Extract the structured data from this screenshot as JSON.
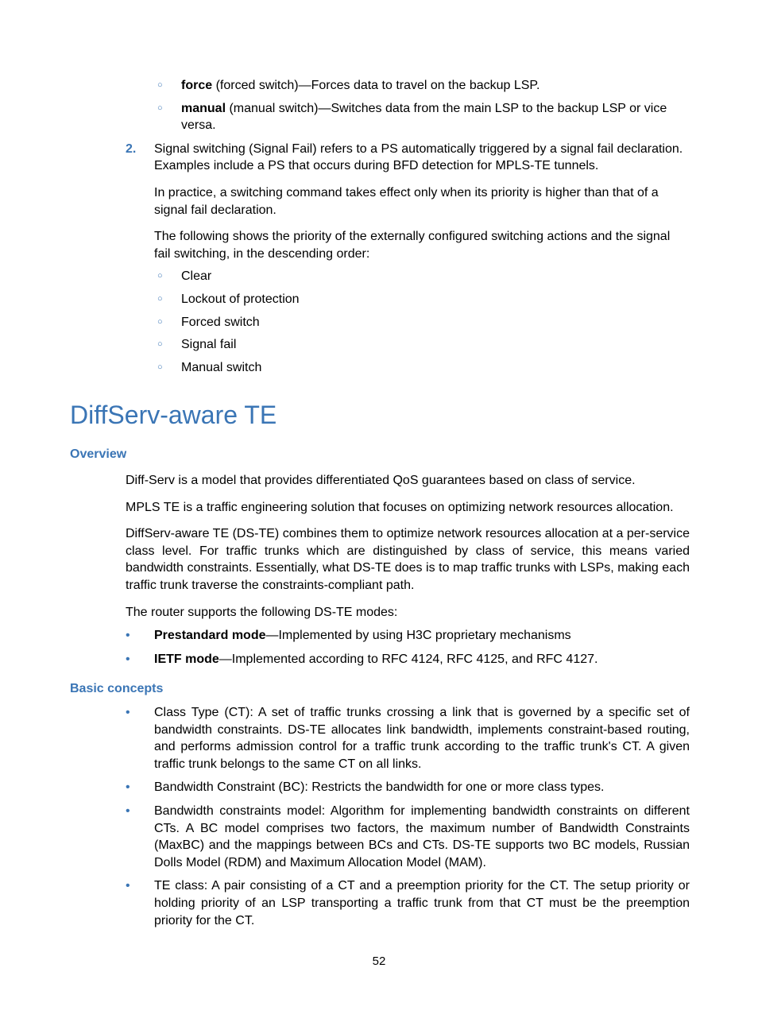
{
  "top": {
    "sub_items_a": [
      {
        "bold": "force",
        "rest": " (forced switch)—Forces data to travel on the backup LSP."
      },
      {
        "bold": "manual",
        "rest": " (manual switch)—Switches data from the main LSP to the backup LSP or vice versa."
      }
    ],
    "num2": "2.",
    "num2_text": "Signal switching (Signal Fail) refers to a PS automatically triggered by a signal fail declaration. Examples include a PS that occurs during BFD detection for MPLS-TE tunnels.",
    "num2_p2": "In practice, a switching command takes effect only when its priority is higher than that of a signal fail declaration.",
    "num2_p3": "The following shows the priority of the externally configured switching actions and the signal fail switching, in the descending order:",
    "priority_list": [
      "Clear",
      "Lockout of protection",
      "Forced switch",
      "Signal fail",
      "Manual switch"
    ]
  },
  "section_title": "DiffServ-aware TE",
  "overview": {
    "heading": "Overview",
    "p1": "Diff-Serv is a model that provides differentiated QoS guarantees based on class of service.",
    "p2": "MPLS TE is a traffic engineering solution that focuses on optimizing network resources allocation.",
    "p3": "DiffServ-aware TE (DS-TE) combines them to optimize network resources allocation at a per-service class level. For traffic trunks which are distinguished by class of service, this means varied bandwidth constraints. Essentially, what DS-TE does is to map traffic trunks with LSPs, making each traffic trunk traverse the constraints-compliant path.",
    "p4": "The router supports the following DS-TE modes:",
    "modes": [
      {
        "bold": "Prestandard mode",
        "rest": "—Implemented by using H3C proprietary mechanisms"
      },
      {
        "bold": "IETF mode",
        "rest": "—Implemented according to RFC 4124, RFC 4125, and RFC 4127."
      }
    ]
  },
  "basic": {
    "heading": "Basic concepts",
    "items": [
      "Class Type (CT): A set of traffic trunks crossing a link that is governed by a specific set of bandwidth constraints. DS-TE allocates link bandwidth, implements constraint-based routing, and performs admission control for a traffic trunk according to the traffic trunk's CT. A given traffic trunk belongs to the same CT on all links.",
      "Bandwidth Constraint (BC): Restricts the bandwidth for one or more class types.",
      "Bandwidth constraints model: Algorithm for implementing bandwidth constraints on different CTs. A BC model comprises two factors, the maximum number of Bandwidth Constraints (MaxBC) and the mappings between BCs and CTs. DS-TE supports two BC models, Russian Dolls Model (RDM) and Maximum Allocation Model (MAM).",
      "TE class: A pair consisting of a CT and a preemption priority for the CT. The setup priority or holding priority of an LSP transporting a traffic trunk from that CT must be the preemption priority for the CT."
    ]
  },
  "page_number": "52"
}
